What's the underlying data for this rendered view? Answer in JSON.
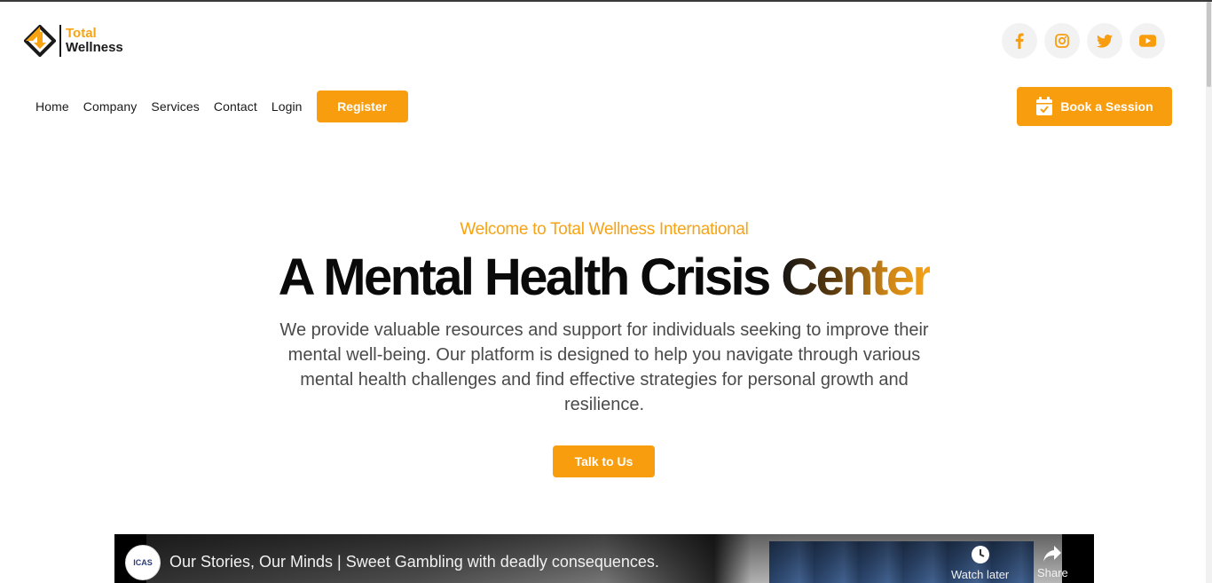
{
  "brand": {
    "name_line1": "Total",
    "name_line2": "Wellness",
    "accent_color": "#f89d0e"
  },
  "social": [
    {
      "icon": "facebook-icon"
    },
    {
      "icon": "instagram-icon"
    },
    {
      "icon": "twitter-icon"
    },
    {
      "icon": "youtube-icon"
    }
  ],
  "nav": {
    "items": [
      "Home",
      "Company",
      "Services",
      "Contact",
      "Login"
    ],
    "register_label": "Register",
    "book_label": "Book a Session"
  },
  "hero": {
    "welcome": "Welcome to Total Wellness International",
    "headline_main": "A Mental Health Crisis ",
    "headline_accent": "Center",
    "lead": "We provide valuable resources and support for individuals seeking to improve their mental well-being. Our platform is designed to help you navigate through various mental health challenges and find effective strategies for personal growth and resilience.",
    "cta_label": "Talk to Us"
  },
  "video": {
    "channel": "ICAS",
    "title": "Our Stories, Our Minds | Sweet Gambling with deadly consequences.",
    "watch_later": "Watch later",
    "share": "Share"
  }
}
